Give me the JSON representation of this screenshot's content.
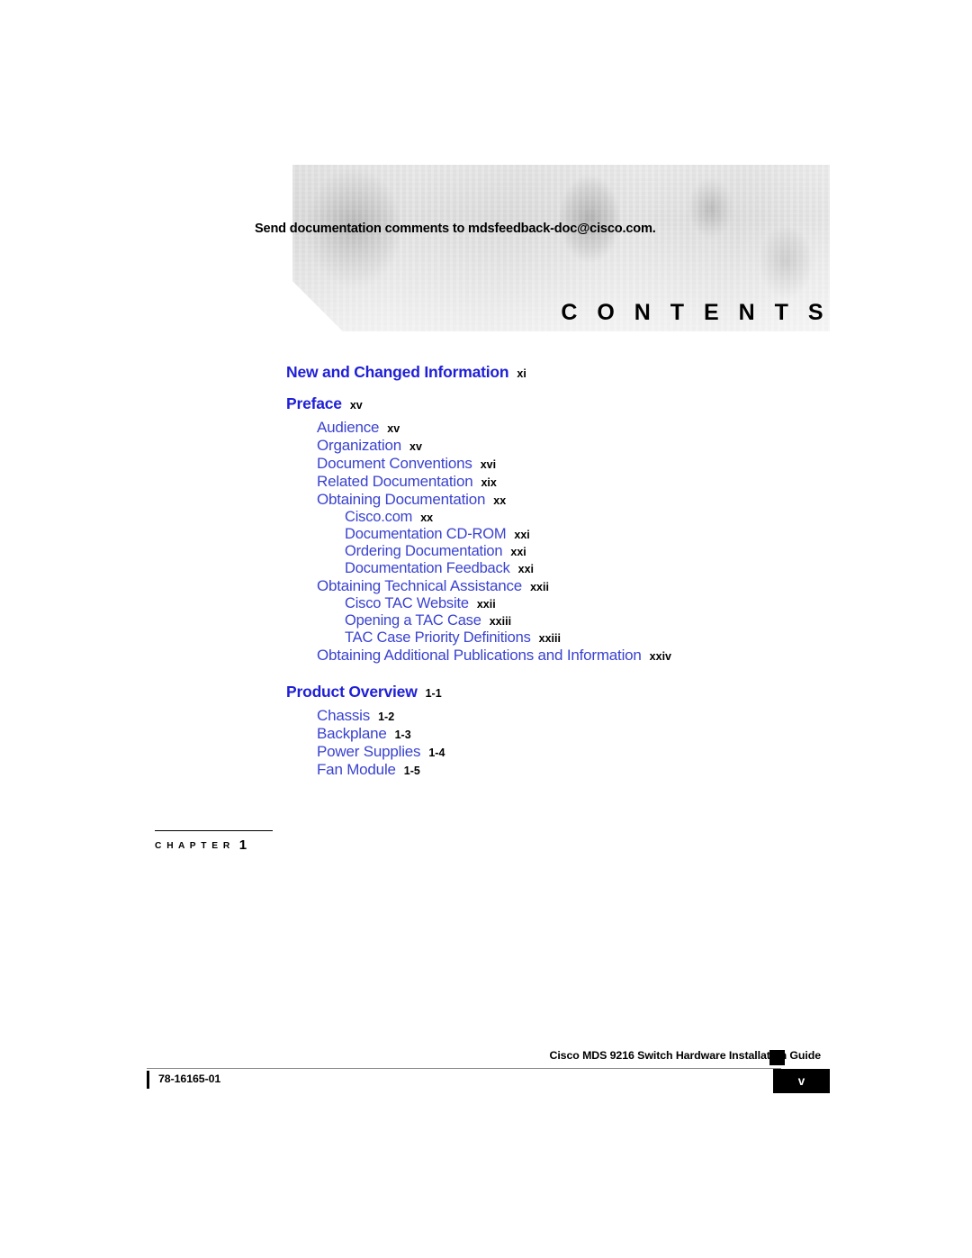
{
  "page": {
    "feedback_notice": "Send documentation comments to mdsfeedback-doc@cisco.com.",
    "contents_title": "C O N T E N T S"
  },
  "toc": {
    "entries": [
      {
        "level": 0,
        "title": "New and Changed Information",
        "page": "xi",
        "spacing": "none"
      },
      {
        "level": 0,
        "title": "Preface",
        "page": "xv",
        "spacing": "gap-sm"
      },
      {
        "level": 1,
        "title": "Audience",
        "page": "xv",
        "spacing": "none"
      },
      {
        "level": 1,
        "title": "Organization",
        "page": "xv",
        "spacing": "none"
      },
      {
        "level": 1,
        "title": "Document Conventions",
        "page": "xvi",
        "spacing": "none"
      },
      {
        "level": 1,
        "title": "Related Documentation",
        "page": "xix",
        "spacing": "none"
      },
      {
        "level": 1,
        "title": "Obtaining Documentation",
        "page": "xx",
        "spacing": "none"
      },
      {
        "level": 2,
        "title": "Cisco.com",
        "page": "xx",
        "spacing": "none"
      },
      {
        "level": 2,
        "title": "Documentation CD-ROM",
        "page": "xxi",
        "spacing": "none"
      },
      {
        "level": 2,
        "title": "Ordering Documentation",
        "page": "xxi",
        "spacing": "none"
      },
      {
        "level": 2,
        "title": "Documentation Feedback",
        "page": "xxi",
        "spacing": "none"
      },
      {
        "level": 1,
        "title": "Obtaining Technical Assistance",
        "page": "xxii",
        "spacing": "none"
      },
      {
        "level": 2,
        "title": "Cisco TAC Website",
        "page": "xxii",
        "spacing": "none"
      },
      {
        "level": 2,
        "title": "Opening a TAC Case",
        "page": "xxiii",
        "spacing": "none"
      },
      {
        "level": 2,
        "title": "TAC Case Priority Definitions",
        "page": "xxiii",
        "spacing": "none"
      },
      {
        "level": 1,
        "title": "Obtaining Additional Publications and Information",
        "page": "xxiv",
        "spacing": "none"
      },
      {
        "level": 0,
        "title": "Product Overview",
        "page": "1-1",
        "spacing": "gap-md"
      },
      {
        "level": 1,
        "title": "Chassis",
        "page": "1-2",
        "spacing": "none"
      },
      {
        "level": 1,
        "title": "Backplane",
        "page": "1-3",
        "spacing": "none"
      },
      {
        "level": 1,
        "title": "Power Supplies",
        "page": "1-4",
        "spacing": "none"
      },
      {
        "level": 1,
        "title": "Fan Module",
        "page": "1-5",
        "spacing": "none"
      }
    ]
  },
  "chapter_marker": {
    "label": "C H A P T E R",
    "number": "1"
  },
  "footer": {
    "guide_title": "Cisco MDS 9216 Switch Hardware Installation Guide",
    "document_number": "78-16165-01",
    "page_number": "v"
  },
  "colors": {
    "heading_blue": "#1f1fd6",
    "entry_blue": "#3a42cf",
    "black": "#000000",
    "footer_rule": "#8a8a8a"
  }
}
